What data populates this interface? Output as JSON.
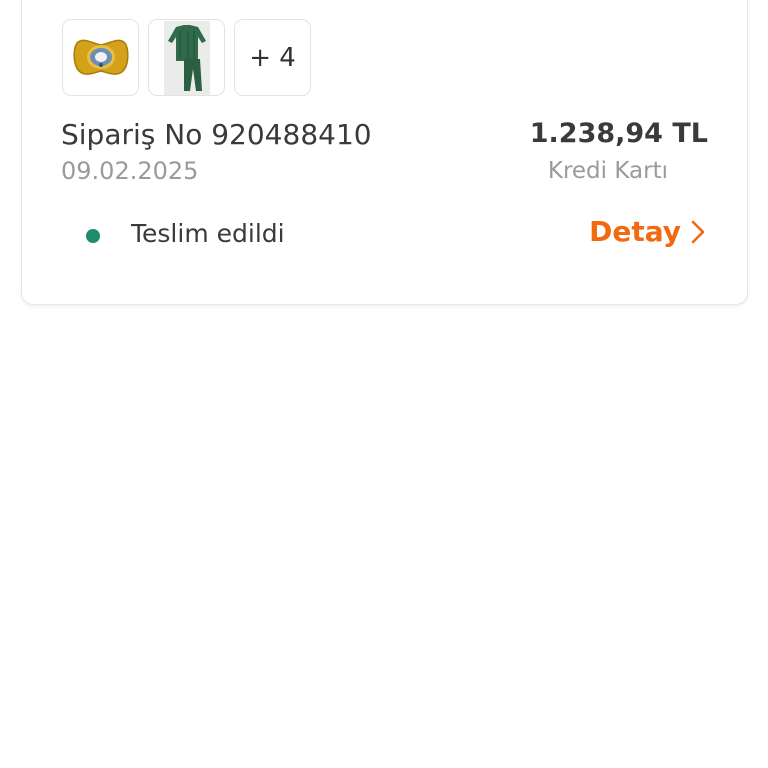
{
  "order": {
    "thumbnails": [
      {
        "icon": "pacifier-icon",
        "alt": "Pacifier product image"
      },
      {
        "icon": "green-pajama-set-icon",
        "alt": "Green pajama set product image"
      }
    ],
    "more_count_label": "+ 4",
    "order_number_label": "Sipariş No 920488410",
    "date": "09.02.2025",
    "amount": "1.238,94 TL",
    "payment_method": "Kredi Kartı",
    "status": {
      "label": "Teslim edildi",
      "color": "#1f8a6c"
    },
    "detail_link": {
      "label": "Detay",
      "icon": "chevron-right-icon",
      "color": "#f26a10"
    }
  }
}
